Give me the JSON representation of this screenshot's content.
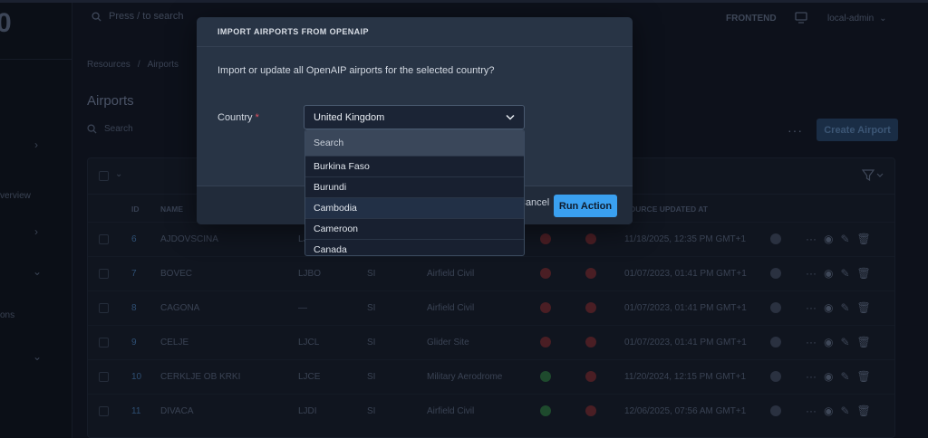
{
  "sidebar": {
    "logo": "0",
    "texts": [
      "verview",
      "ons"
    ]
  },
  "header": {
    "search_placeholder": "Press / to search",
    "frontend_label": "FRONTEND",
    "user_label": "local-admin"
  },
  "breadcrumb": {
    "items": [
      "Resources",
      "Airports"
    ]
  },
  "page": {
    "title": "Airports",
    "search_placeholder": "Search",
    "create_label": "Create Airport"
  },
  "table": {
    "headers": {
      "id": "ID",
      "name": "NAME",
      "updated": "SOURCE UPDATED AT"
    },
    "rows": [
      {
        "id": "6",
        "name": "AJDOVSCINA",
        "icao": "LJ..",
        "country": "",
        "type": "",
        "s1": "red",
        "s2": "red",
        "updated": "11/18/2025, 12:35 PM GMT+1"
      },
      {
        "id": "7",
        "name": "BOVEC",
        "icao": "LJBO",
        "country": "SI",
        "type": "Airfield Civil",
        "s1": "red",
        "s2": "red",
        "updated": "01/07/2023, 01:41 PM GMT+1"
      },
      {
        "id": "8",
        "name": "CAGONA",
        "icao": "—",
        "country": "SI",
        "type": "Airfield Civil",
        "s1": "red",
        "s2": "red",
        "updated": "01/07/2023, 01:41 PM GMT+1"
      },
      {
        "id": "9",
        "name": "CELJE",
        "icao": "LJCL",
        "country": "SI",
        "type": "Glider Site",
        "s1": "red",
        "s2": "red",
        "updated": "01/07/2023, 01:41 PM GMT+1"
      },
      {
        "id": "10",
        "name": "CERKLJE OB KRKI",
        "icao": "LJCE",
        "country": "SI",
        "type": "Military Aerodrome",
        "s1": "green",
        "s2": "red",
        "updated": "11/20/2024, 12:15 PM GMT+1"
      },
      {
        "id": "11",
        "name": "DIVACA",
        "icao": "LJDI",
        "country": "SI",
        "type": "Airfield Civil",
        "s1": "green",
        "s2": "red",
        "updated": "12/06/2025, 07:56 AM GMT+1"
      }
    ]
  },
  "modal": {
    "title": "IMPORT AIRPORTS FROM OPENAIP",
    "description": "Import or update all OpenAIP airports for the selected country?",
    "country_label": "Country",
    "required_mark": "*",
    "selected_country": "United Kingdom",
    "cancel_label": "Cancel",
    "run_label": "Run Action"
  },
  "dropdown": {
    "search_placeholder": "Search",
    "options": [
      "Burkina Faso",
      "Burundi",
      "Cambodia",
      "Cameroon",
      "Canada"
    ],
    "highlighted": "Cambodia"
  },
  "colors": {
    "accent": "#3aa0f0",
    "modal_bg": "#283445",
    "required": "#e05260"
  }
}
